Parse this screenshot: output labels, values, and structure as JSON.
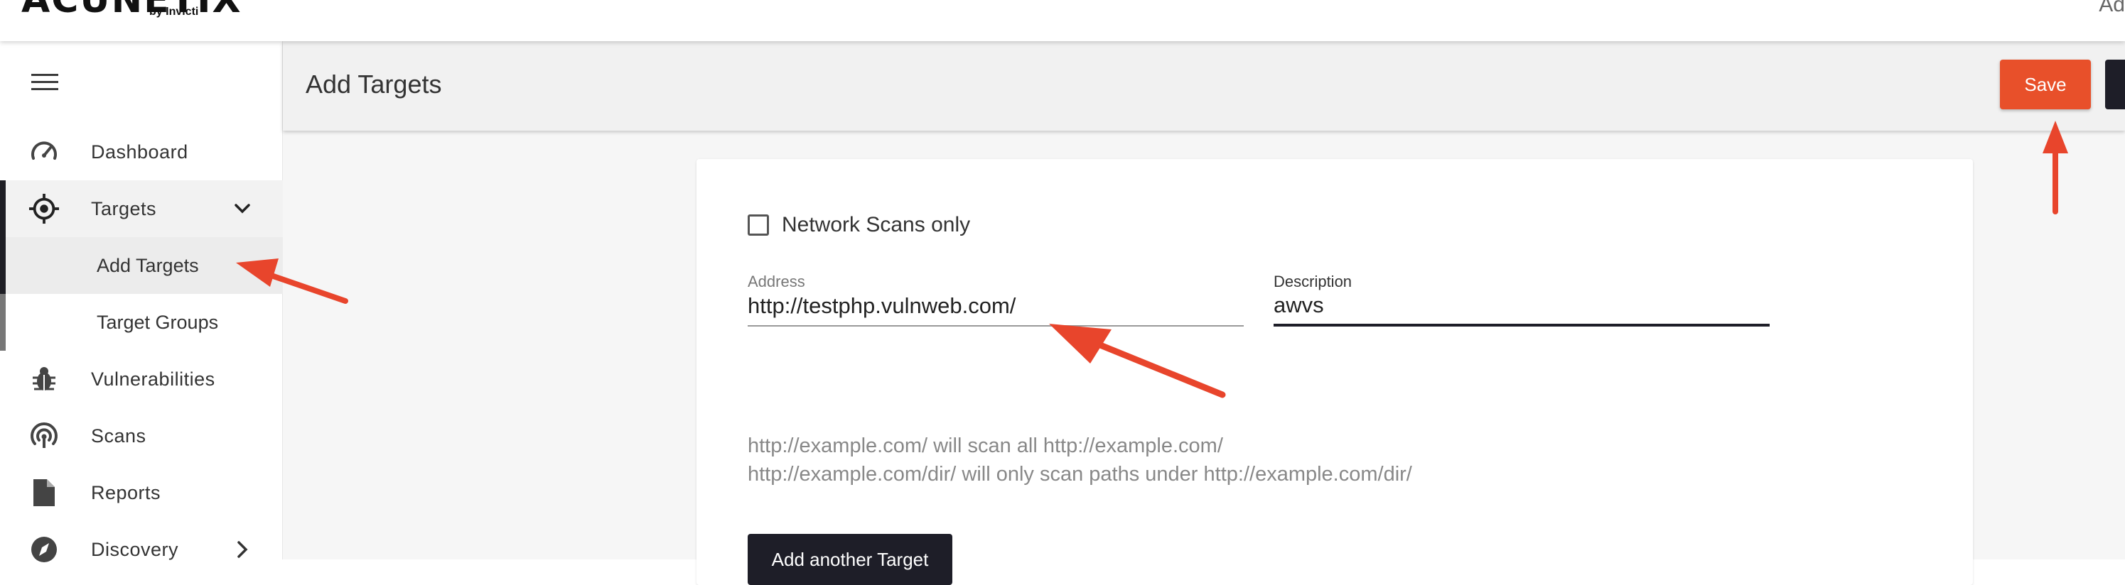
{
  "app": {
    "logo_text": "ACUNETIX",
    "logo_sub": "by Invicti",
    "top_right_text": "Ad"
  },
  "sidebar": {
    "items": [
      {
        "label": "Dashboard",
        "icon": "dashboard-gauge-icon"
      },
      {
        "label": "Targets",
        "icon": "target-crosshair-icon",
        "expanded": true
      },
      {
        "label": "Vulnerabilities",
        "icon": "bug-icon"
      },
      {
        "label": "Scans",
        "icon": "scans-radar-icon"
      },
      {
        "label": "Reports",
        "icon": "report-file-icon"
      },
      {
        "label": "Discovery",
        "icon": "compass-icon"
      }
    ],
    "subitems": [
      {
        "label": "Add Targets",
        "selected": true
      },
      {
        "label": "Target Groups"
      }
    ]
  },
  "header": {
    "title": "Add Targets",
    "save_label": "Save"
  },
  "form": {
    "network_scans_only_label": "Network Scans only",
    "network_scans_only_checked": false,
    "address_label": "Address",
    "address_value": "http://testphp.vulnweb.com/",
    "description_label": "Description",
    "description_value": "awvs",
    "hint_line1": "http://example.com/ will scan all http://example.com/",
    "hint_line2": "http://example.com/dir/ will only scan paths under http://example.com/dir/",
    "add_another_label": "Add another Target"
  },
  "colors": {
    "accent_orange": "#e8502a",
    "dark": "#1e1e28",
    "annotation_red": "#e8452c"
  }
}
